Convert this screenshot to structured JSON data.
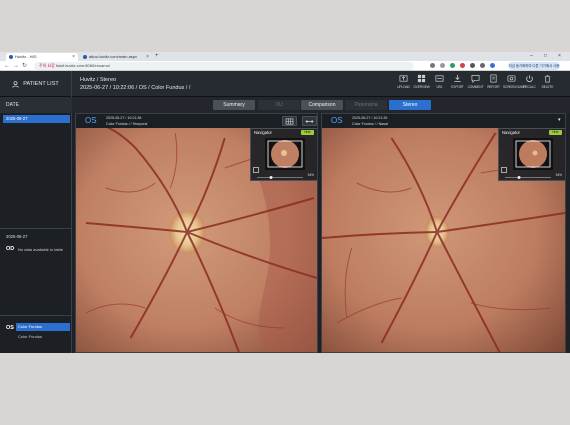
{
  "browser": {
    "tabs": [
      {
        "label": "Huvitz - HIG",
        "active": true
      },
      {
        "label": "atlus.huvitz.com/main.aspx",
        "active": false
      }
    ],
    "address": {
      "warning": "주의 요함",
      "url": "fsisit.huvitz.com:8080/reuamo/"
    },
    "sync_label": "지금 동기화하여 다른 기기에서 사용"
  },
  "app": {
    "patient_list_label": "PATIENT LIST",
    "breadcrumb": {
      "line1": "Huvitz / Stereo",
      "line2": "2025-06-27 / 10:22:06 / OS / Color Fundus / /"
    },
    "toolbar": [
      {
        "label": "UPLOAD",
        "icon": "upload-icon"
      },
      {
        "label": "OVERVIEW",
        "icon": "overview-icon"
      },
      {
        "label": "URL",
        "icon": "url-icon"
      },
      {
        "label": "EXPORT",
        "icon": "export-icon"
      },
      {
        "label": "COMMENT",
        "icon": "comment-icon"
      },
      {
        "label": "REPORT",
        "icon": "report-icon"
      },
      {
        "label": "SCREEN DUMP",
        "icon": "screen-dump-icon"
      },
      {
        "label": "RECALC",
        "icon": "recalc-icon"
      },
      {
        "label": "DELETE",
        "icon": "delete-icon"
      }
    ]
  },
  "sidebar": {
    "header": "DATE",
    "selected_date": "2025-06-27",
    "date2": "2025-06-27",
    "od_label": "OD",
    "od_empty": "No data available in table",
    "os_label": "OS",
    "os_items": [
      "Color Fundus",
      "Color Fundus"
    ]
  },
  "view_tabs": [
    {
      "label": "Summary",
      "state": "normal"
    },
    {
      "label": "OU",
      "state": "disabled"
    },
    {
      "label": "Comparison",
      "state": "normal"
    },
    {
      "label": "Panorama",
      "state": "disabled"
    },
    {
      "label": "Stereo",
      "state": "active"
    }
  ],
  "panes": {
    "left": {
      "eye": "OS",
      "timestamp": "2025-06-27 / 10:21:38",
      "desc": "Color Fundus / / Temporal",
      "navigator": {
        "title": "Navigator",
        "hide_label": "Hide",
        "zoom": "34%"
      }
    },
    "right": {
      "eye": "OS",
      "timestamp": "2025-06-27 / 10:21:39",
      "desc": "Color Fundus / / Nasal",
      "navigator": {
        "title": "Navigator",
        "hide_label": "Hide",
        "zoom": "34%"
      }
    }
  },
  "colors": {
    "accent": "#2b6fcf",
    "hide_badge": "#9ccc3c",
    "background": "#1e2227"
  }
}
